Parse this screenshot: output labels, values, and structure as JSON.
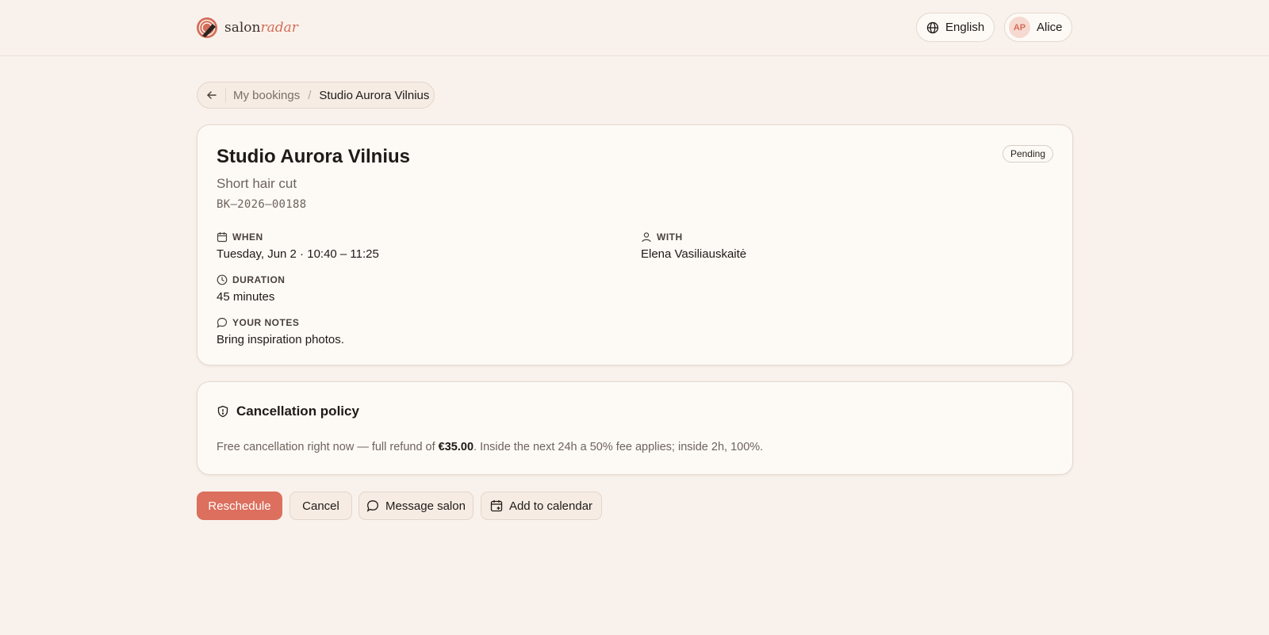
{
  "header": {
    "logo": {
      "prefix": "salon",
      "suffix": "radar"
    },
    "language": "English",
    "user": {
      "initials": "AP",
      "name": "Alice"
    }
  },
  "breadcrumb": {
    "parent": "My bookings",
    "separator": "/",
    "current": "Studio Aurora Vilnius"
  },
  "booking": {
    "salon_name": "Studio Aurora Vilnius",
    "status": "Pending",
    "service": "Short hair cut",
    "reference": "BK–2026–00188",
    "fields": {
      "when": {
        "label": "WHEN",
        "value": "Tuesday, Jun 2 · 10:40 – 11:25"
      },
      "with": {
        "label": "WITH",
        "value": "Elena Vasiliauskaitė"
      },
      "duration": {
        "label": "DURATION",
        "value": "45 minutes"
      },
      "notes": {
        "label": "YOUR NOTES",
        "value": "Bring inspiration photos."
      }
    }
  },
  "policy": {
    "title": "Cancellation policy",
    "text_before": "Free cancellation right now — full refund of ",
    "amount": "€35.00",
    "text_after": ". Inside the next 24h a 50% fee applies; inside 2h, 100%."
  },
  "actions": {
    "reschedule": "Reschedule",
    "cancel": "Cancel",
    "message": "Message salon",
    "calendar": "Add to calendar"
  },
  "colors": {
    "background": "#f9f2ec",
    "card": "#fdfaf6",
    "accent": "#dc6f5d",
    "text": "#1f1a17",
    "muted": "#6f635c"
  }
}
